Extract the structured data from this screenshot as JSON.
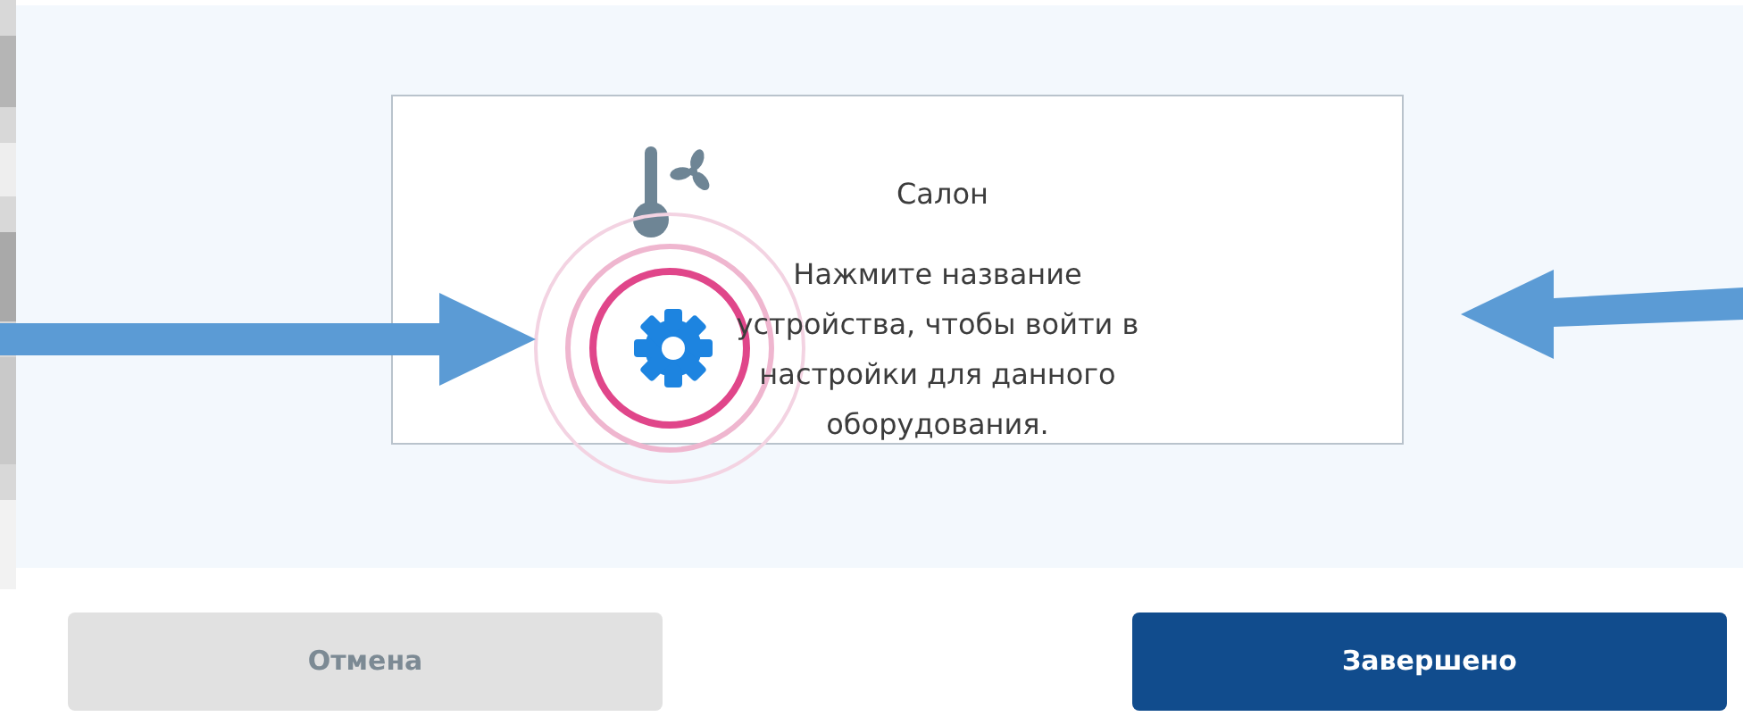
{
  "card": {
    "title": "Салон",
    "instruction": "Нажмите название устройства, чтобы войти в настройки для данного оборудования."
  },
  "buttons": [
    {
      "label": "Отмена",
      "kind": "secondary"
    },
    {
      "label": "Завершено",
      "kind": "primary"
    }
  ]
}
